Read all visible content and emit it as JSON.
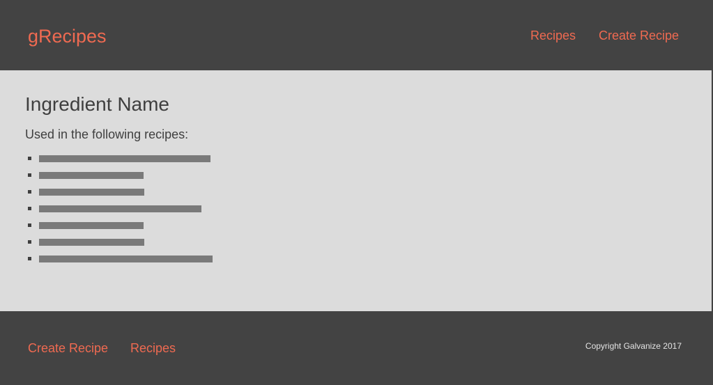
{
  "header": {
    "brand": "gRecipes",
    "nav": [
      {
        "label": "Recipes"
      },
      {
        "label": "Create Recipe"
      }
    ]
  },
  "main": {
    "title": "Ingredient Name",
    "subtitle": "Used in the following recipes:",
    "recipes": [
      {
        "label": ""
      },
      {
        "label": ""
      },
      {
        "label": ""
      },
      {
        "label": ""
      },
      {
        "label": ""
      },
      {
        "label": ""
      },
      {
        "label": ""
      }
    ]
  },
  "footer": {
    "links": [
      {
        "label": "Create Recipe"
      },
      {
        "label": "Recipes"
      }
    ],
    "copyright": "Copyright Galvanize 2017"
  },
  "colors": {
    "accent": "#ef6a51",
    "header_bg": "#434343",
    "content_bg": "#dcdcdc",
    "text": "#3f3f3f",
    "placeholder_bar": "#7a7a7a"
  }
}
